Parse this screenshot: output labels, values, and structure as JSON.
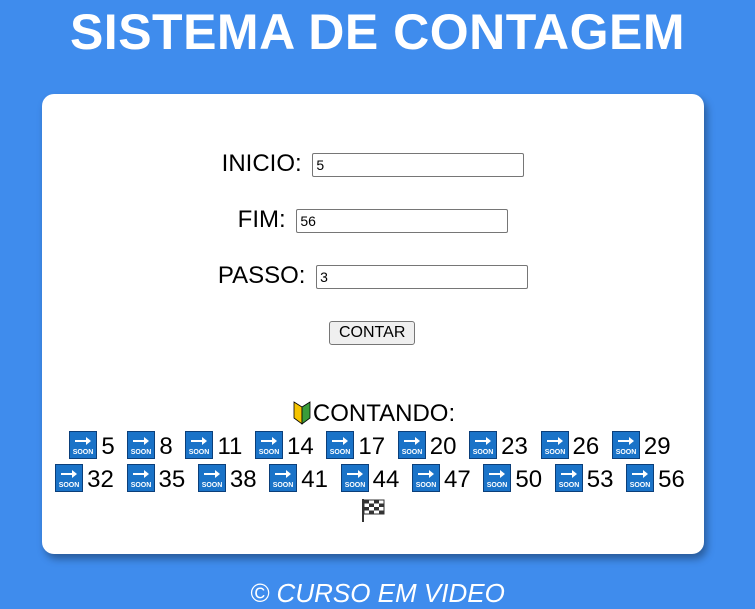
{
  "header": {
    "title": "SISTEMA DE CONTAGEM"
  },
  "form": {
    "inicio_label": "INICIO:",
    "inicio_value": "5",
    "fim_label": "FIM:",
    "fim_value": "56",
    "passo_label": "PASSO:",
    "passo_value": "3",
    "button_label": "CONTAR"
  },
  "result": {
    "header_icon": "japanese-beginner-symbol-icon",
    "header_label": "CONTANDO:",
    "step_icon": "soon-arrow-icon",
    "end_icon": "checkered-flag-icon",
    "numbers": [
      "5",
      "8",
      "11",
      "14",
      "17",
      "20",
      "23",
      "26",
      "29",
      "32",
      "35",
      "38",
      "41",
      "44",
      "47",
      "50",
      "53",
      "56"
    ]
  },
  "footer": {
    "text": "© CURSO EM VIDEO"
  },
  "colors": {
    "background": "#3f8ced",
    "card": "#ffffff",
    "soon_icon": "#1a73c8"
  }
}
